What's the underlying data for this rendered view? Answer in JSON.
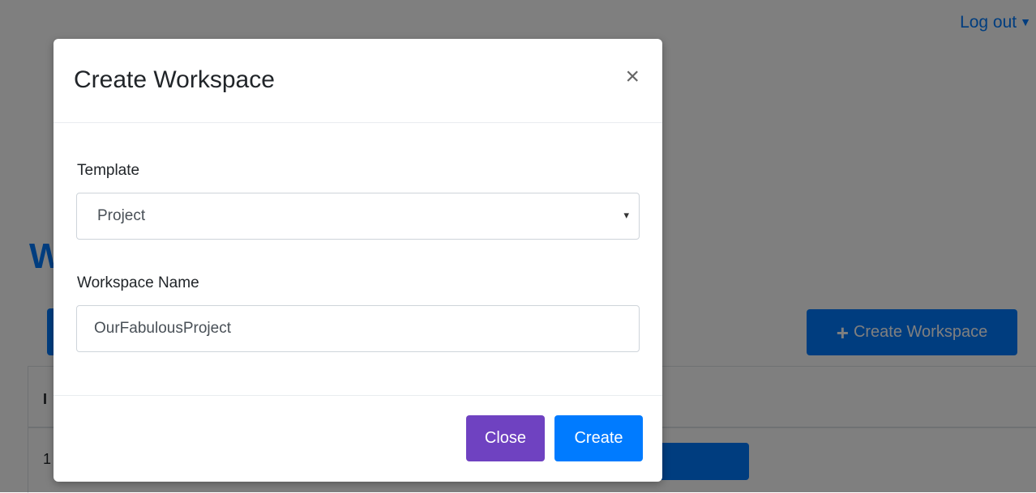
{
  "header": {
    "logout_label": "Log out"
  },
  "page": {
    "heading_partial": "W",
    "create_button_label": "Create Workspace",
    "table": {
      "header_partial": "I",
      "first_cell_partial": "1"
    }
  },
  "modal": {
    "title": "Create Workspace",
    "close_symbol": "×",
    "template": {
      "label": "Template",
      "selected": "Project",
      "arrow": "▾"
    },
    "workspace_name": {
      "label": "Workspace Name",
      "value": "OurFabulousProject"
    },
    "buttons": {
      "close": "Close",
      "create": "Create"
    }
  },
  "colors": {
    "primary": "#007bff",
    "close_button": "#6f42c1",
    "backdrop": "rgba(0,0,0,0.5)"
  },
  "icons": [
    "caret-down-icon",
    "plus-icon",
    "close-icon",
    "select-arrow-icon"
  ]
}
